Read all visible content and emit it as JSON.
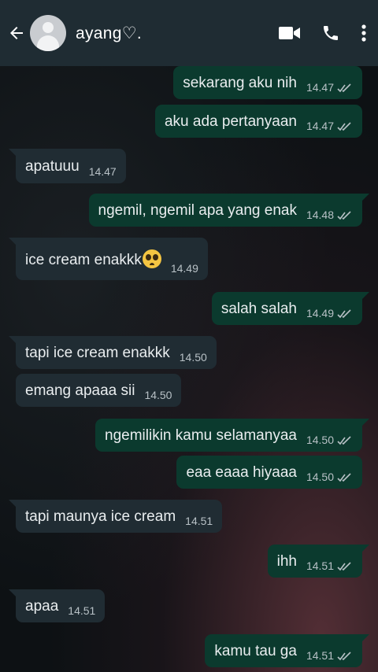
{
  "header": {
    "contact_name": "ayang♡."
  },
  "messages": [
    {
      "text": "sekarang aku nih",
      "time": "14.47",
      "dir": "out"
    },
    {
      "text": "aku ada pertanyaan",
      "time": "14.47",
      "dir": "out"
    },
    {
      "text": "apatuuu",
      "time": "14.47",
      "dir": "in"
    },
    {
      "text": "ngemil, ngemil apa yang enak",
      "time": "14.48",
      "dir": "out"
    },
    {
      "text": "ice cream enakkk",
      "time": "14.49",
      "dir": "in",
      "emoji": "pleading-face"
    },
    {
      "text": "salah salah",
      "time": "14.49",
      "dir": "out"
    },
    {
      "text": "tapi ice cream enakkk",
      "time": "14.50",
      "dir": "in"
    },
    {
      "text": "emang apaaa sii",
      "time": "14.50",
      "dir": "in"
    },
    {
      "text": "ngemilikin kamu selamanyaa",
      "time": "14.50",
      "dir": "out"
    },
    {
      "text": "eaa eaaa hiyaaa",
      "time": "14.50",
      "dir": "out"
    },
    {
      "text": "tapi maunya ice cream",
      "time": "14.51",
      "dir": "in"
    },
    {
      "text": "ihh",
      "time": "14.51",
      "dir": "out"
    },
    {
      "text": "apaa",
      "time": "14.51",
      "dir": "in"
    },
    {
      "text": "kamu tau ga",
      "time": "14.51",
      "dir": "out"
    }
  ],
  "colors": {
    "header_bg": "#1f2c33",
    "incoming_bubble": "#202c33",
    "outgoing_bubble": "#0b3a2e",
    "read_ticks": "#b8c1c6"
  }
}
